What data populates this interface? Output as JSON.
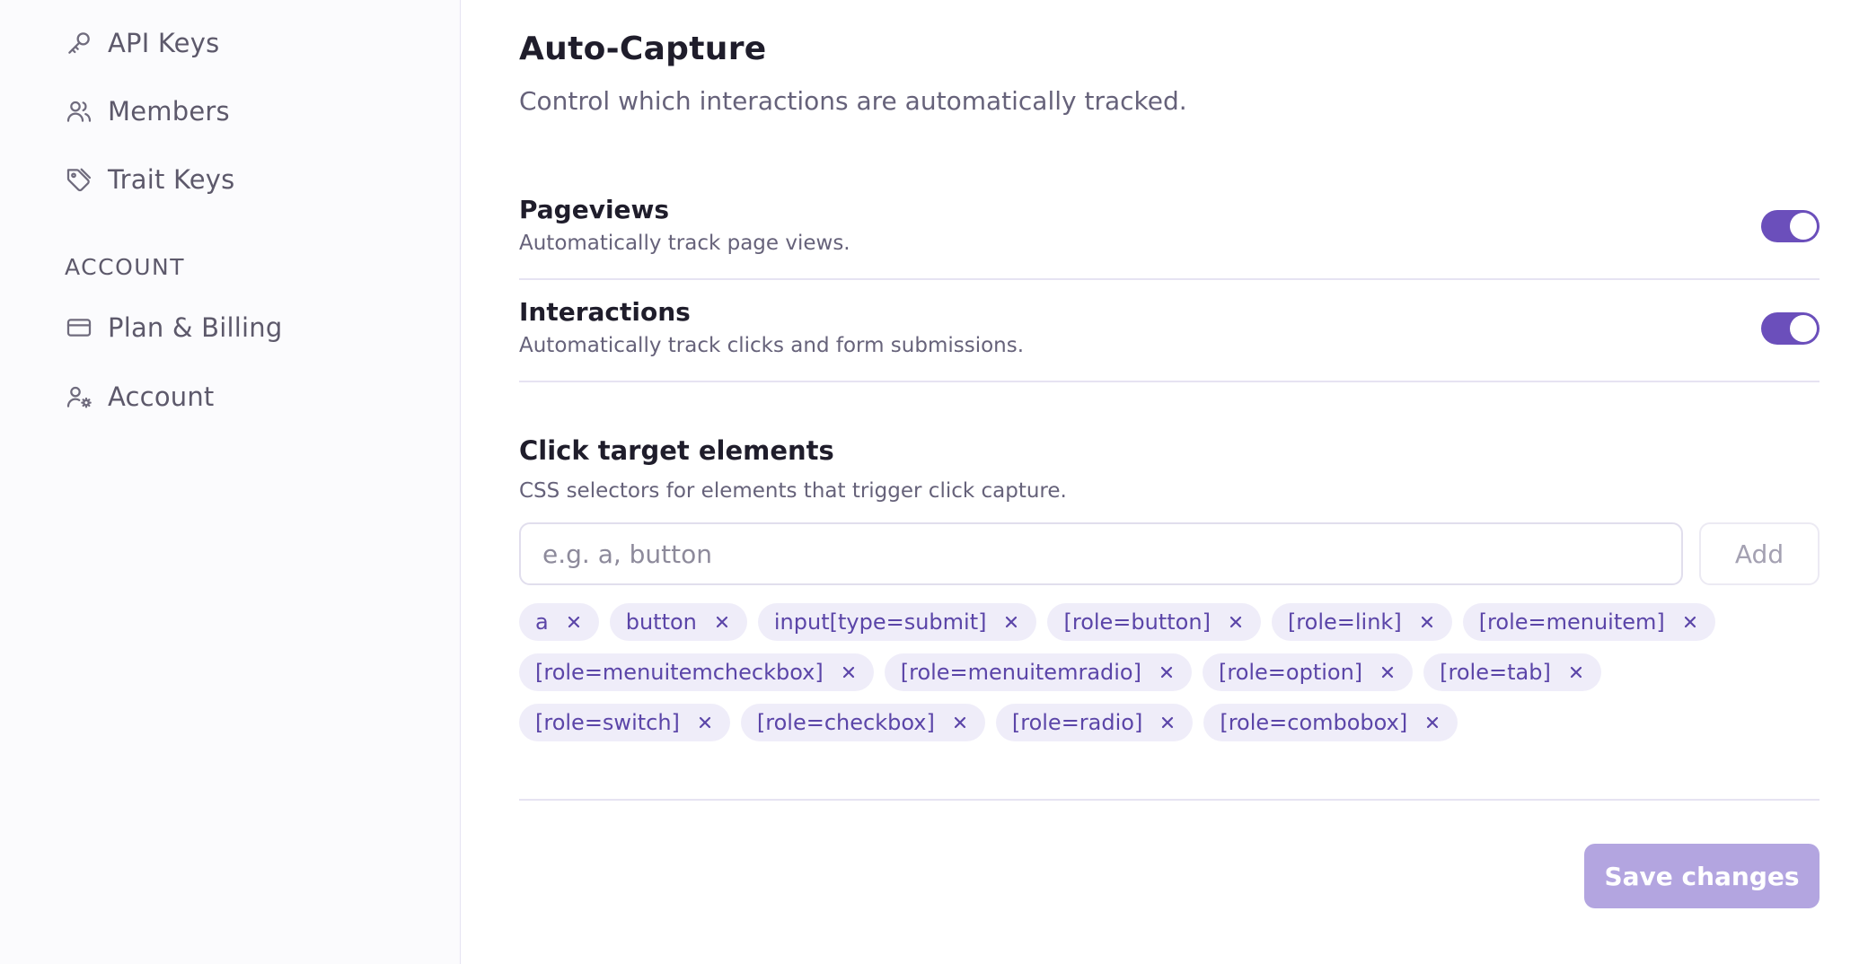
{
  "sidebar": {
    "items": [
      {
        "label": "API Keys",
        "icon": "key-icon"
      },
      {
        "label": "Members",
        "icon": "users-icon"
      },
      {
        "label": "Trait Keys",
        "icon": "tag-icon"
      }
    ],
    "account_heading": "ACCOUNT",
    "account_items": [
      {
        "label": "Plan & Billing",
        "icon": "credit-card-icon"
      },
      {
        "label": "Account",
        "icon": "user-settings-icon"
      }
    ]
  },
  "main": {
    "title": "Auto-Capture",
    "subtitle": "Control which interactions are automatically tracked.",
    "pageviews": {
      "title": "Pageviews",
      "description": "Automatically track page views.",
      "enabled": true
    },
    "interactions": {
      "title": "Interactions",
      "description": "Automatically track clicks and form submissions.",
      "enabled": true
    },
    "click_targets": {
      "title": "Click target elements",
      "description": "CSS selectors for elements that trigger click capture.",
      "input_value": "",
      "input_placeholder": "e.g. a, button",
      "add_label": "Add",
      "chips": [
        [
          "a",
          "button",
          "input[type=submit]",
          "[role=button]",
          "[role=link]",
          "[role=menuitem]"
        ],
        [
          "[role=menuitemcheckbox]",
          "[role=menuitemradio]",
          "[role=option]",
          "[role=tab]"
        ],
        [
          "[role=switch]",
          "[role=checkbox]",
          "[role=radio]",
          "[role=combobox]"
        ]
      ]
    },
    "save_label": "Save changes"
  },
  "colors": {
    "accent": "#6b4fbb",
    "accent_disabled": "#b3a5e0",
    "chip_bg": "#efedf9",
    "chip_text": "#5b45a8"
  }
}
